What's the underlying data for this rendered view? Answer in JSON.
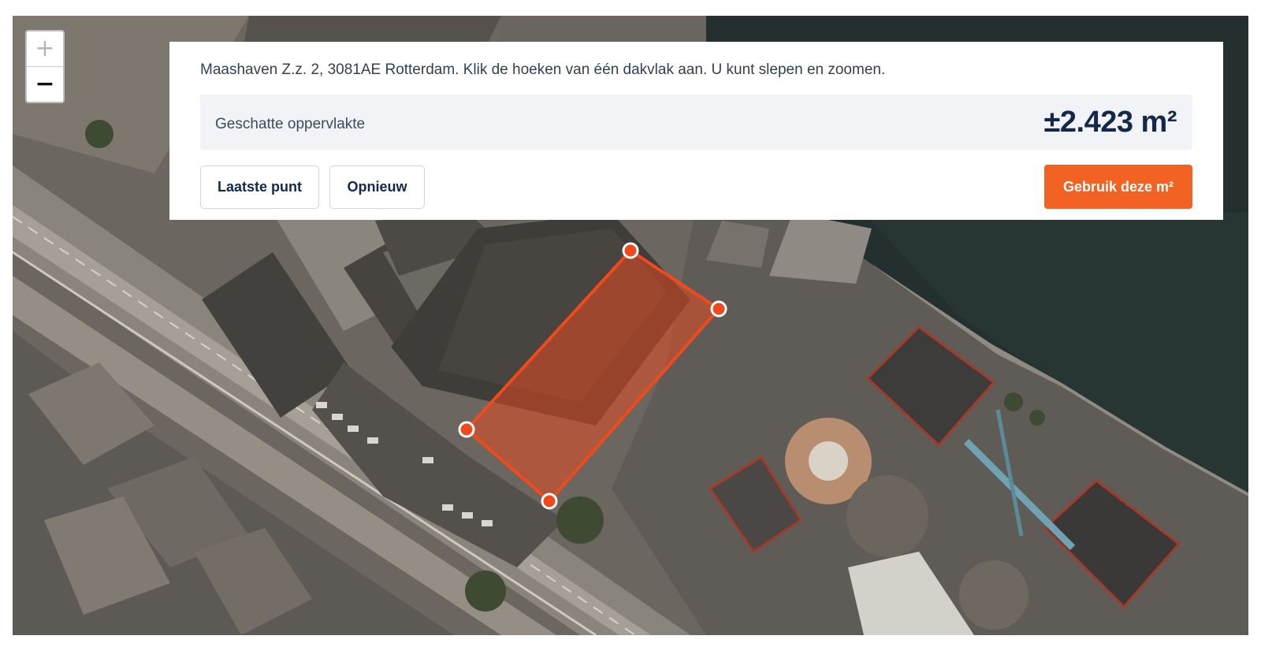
{
  "map": {
    "zoom_in_label": "+",
    "zoom_out_label": "−",
    "polygon_color": "#f04a1c",
    "vertex_count": 4
  },
  "panel": {
    "instructions": "Maashaven Z.z. 2, 3081AE Rotterdam. Klik de hoeken van één dakvlak aan. U kunt slepen en zoomen.",
    "area_label": "Geschatte oppervlakte",
    "area_value": "±2.423 m²"
  },
  "actions": {
    "undo_label": "Laatste punt",
    "reset_label": "Opnieuw",
    "use_label": "Gebruik deze m²"
  },
  "colors": {
    "accent": "#f26222",
    "heading": "#13284a",
    "panel_bg": "#ffffff",
    "area_bg": "#f1f3f6"
  }
}
